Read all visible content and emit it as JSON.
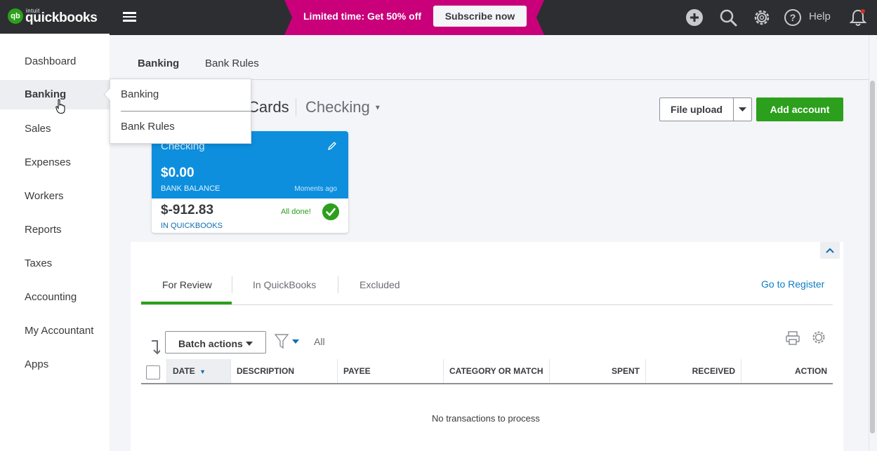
{
  "brand": {
    "small": "intuit",
    "name": "quickbooks"
  },
  "promo": {
    "text": "Limited time: Get 50% off",
    "button": "Subscribe now"
  },
  "topbar": {
    "help_label": "Help"
  },
  "sidebar": {
    "items": [
      {
        "label": "Dashboard"
      },
      {
        "label": "Banking",
        "active": true
      },
      {
        "label": "Sales"
      },
      {
        "label": "Expenses"
      },
      {
        "label": "Workers"
      },
      {
        "label": "Reports"
      },
      {
        "label": "Taxes"
      },
      {
        "label": "Accounting"
      },
      {
        "label": "My Accountant"
      },
      {
        "label": "Apps"
      }
    ]
  },
  "popup": {
    "items": [
      "Banking",
      "Bank Rules"
    ]
  },
  "subtabs": [
    {
      "label": "Banking",
      "active": true
    },
    {
      "label": "Bank Rules"
    }
  ],
  "header": {
    "title_visible": "Cards",
    "account": "Checking"
  },
  "actions": {
    "file_upload": "File upload",
    "add_account": "Add account"
  },
  "card": {
    "name": "Checking",
    "bank_balance": "$0.00",
    "bank_balance_label": "BANK BALANCE",
    "updated": "Moments ago",
    "qb_balance": "$-912.83",
    "qb_balance_label": "IN QUICKBOOKS",
    "status": "All done!"
  },
  "review_tabs": [
    {
      "label": "For Review",
      "active": true
    },
    {
      "label": "In QuickBooks"
    },
    {
      "label": "Excluded"
    }
  ],
  "go_register": "Go to Register",
  "toolbar": {
    "batch_actions": "Batch actions",
    "filter_value": "All"
  },
  "table": {
    "columns": [
      "DATE",
      "DESCRIPTION",
      "PAYEE",
      "CATEGORY OR MATCH",
      "SPENT",
      "RECEIVED",
      "ACTION"
    ],
    "empty_message": "No transactions to process"
  },
  "colors": {
    "brand_green": "#2ca01c",
    "promo_magenta": "#c9007a",
    "card_blue": "#0d8fde",
    "topbar": "#2d2e31",
    "link_blue": "#0d7dc4"
  }
}
